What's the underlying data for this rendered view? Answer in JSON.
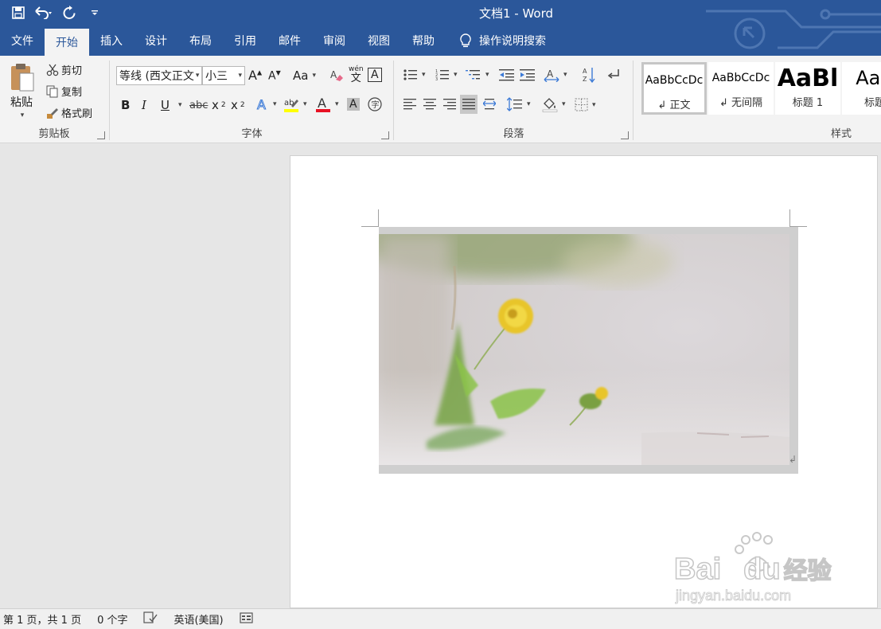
{
  "title_bar": {
    "document_title": "文档1  -  Word",
    "quick_access": [
      {
        "icon": "save-icon"
      },
      {
        "icon": "undo-icon"
      },
      {
        "icon": "redo-icon"
      },
      {
        "icon": "customize-qat-icon"
      }
    ]
  },
  "tabs": [
    "文件",
    "开始",
    "插入",
    "设计",
    "布局",
    "引用",
    "邮件",
    "审阅",
    "视图",
    "帮助"
  ],
  "active_tab": "开始",
  "tell_me": "操作说明搜索",
  "clipboard": {
    "paste": "粘贴",
    "cut": "剪切",
    "copy": "复制",
    "format_painter": "格式刷",
    "group_name": "剪贴板"
  },
  "font": {
    "font_name": "等线 (西文正文",
    "font_size": "小三",
    "case_label": "Aa",
    "phonetic_top": "wén",
    "phonetic_bottom": "文",
    "bold": "B",
    "italic": "I",
    "underline": "U",
    "strikethrough": "abc",
    "subscript": "x",
    "subscript_mark": "2",
    "superscript": "x",
    "superscript_mark": "2",
    "group_name": "字体",
    "highlight_color": "#ffff00",
    "font_color": "#e81123"
  },
  "paragraph": {
    "group_name": "段落"
  },
  "styles": {
    "items": [
      {
        "sample": "AaBbCcDc",
        "name": "正文",
        "size": "14px"
      },
      {
        "sample": "AaBbCcDc",
        "name": "无间隔",
        "size": "14px"
      },
      {
        "sample": "AaBl",
        "name": "标题 1",
        "size": "30px"
      },
      {
        "sample": "AaB",
        "name": "标题",
        "size": "24px"
      }
    ],
    "group_name": "样式"
  },
  "status_bar": {
    "page": "第 1 页，共 1 页",
    "words": "0 个字",
    "language": "英语(美国)"
  },
  "watermark": {
    "brand_left": "Bai",
    "brand_right": "du",
    "brand_cn": "经验",
    "url": "jingyan.baidu.com"
  },
  "colors": {
    "accent": "#2b579a",
    "ribbon": "#f3f3f3",
    "workspace": "#e6e6e6"
  }
}
